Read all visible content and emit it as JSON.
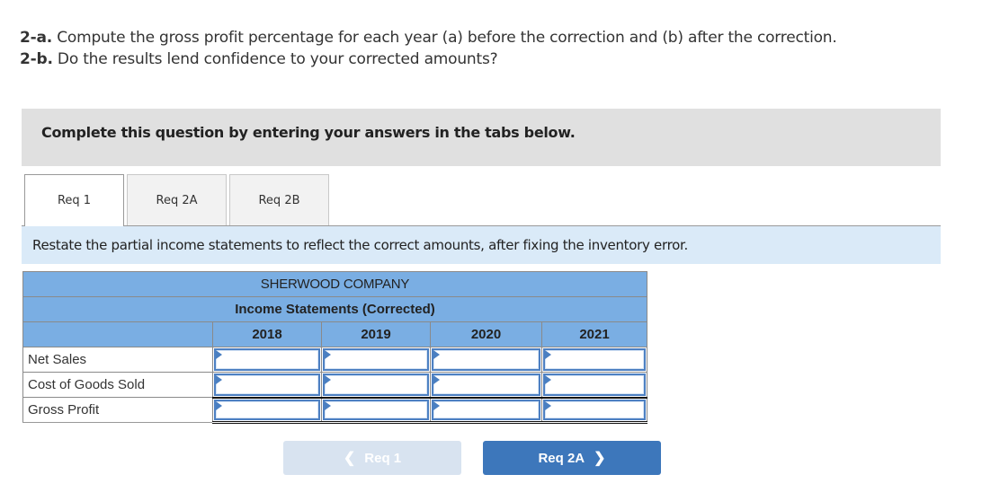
{
  "question": {
    "line1_label": "2-a.",
    "line1_text": " Compute the gross profit percentage for each year (a) before the correction and (b) after the correction.",
    "line2_label": "2-b.",
    "line2_text": " Do the results lend confidence to your corrected amounts?"
  },
  "instruction": "Complete this question by entering your answers in the tabs below.",
  "tabs": [
    {
      "label": "Req 1",
      "active": true
    },
    {
      "label": "Req 2A",
      "active": false
    },
    {
      "label": "Req 2B",
      "active": false
    }
  ],
  "subheading": "Restate the partial income statements to reflect the correct amounts, after fixing the inventory error.",
  "statement": {
    "company": "SHERWOOD COMPANY",
    "title": "Income Statements (Corrected)",
    "years": [
      "2018",
      "2019",
      "2020",
      "2021"
    ],
    "rows": [
      {
        "label": "Net Sales",
        "values": [
          "",
          "",
          "",
          ""
        ]
      },
      {
        "label": "Cost of Goods Sold",
        "values": [
          "",
          "",
          "",
          ""
        ]
      },
      {
        "label": "Gross Profit",
        "values": [
          "",
          "",
          "",
          ""
        ]
      }
    ]
  },
  "nav": {
    "prev_label": "Req 1",
    "next_label": "Req 2A",
    "prev_enabled": false,
    "next_enabled": true
  },
  "colors": {
    "header_blue": "#7aaee3",
    "subhead_blue": "#daeaf8",
    "next_button": "#3d77bb",
    "prev_button_disabled": "#d8e3f0"
  }
}
